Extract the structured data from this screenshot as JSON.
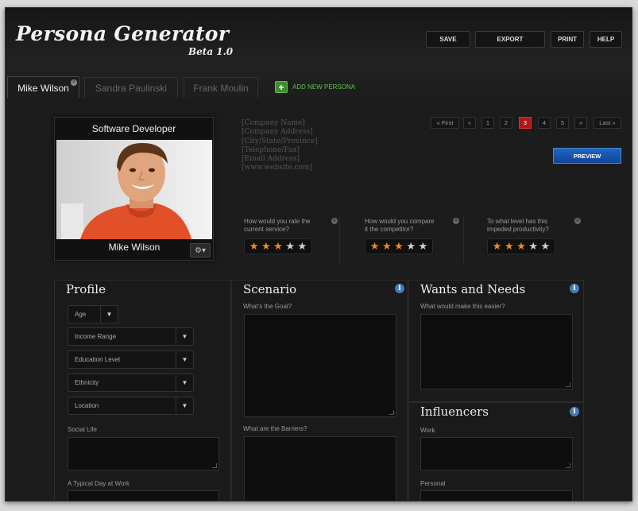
{
  "header": {
    "title": "Persona Generator",
    "subtitle": "Beta 1.0",
    "buttons": {
      "save": "SAVE",
      "export": "EXPORT",
      "print": "PRINT",
      "help": "HELP"
    }
  },
  "tabs": [
    {
      "label": "Mike Wilson",
      "active": true
    },
    {
      "label": "Sandra Paulinski",
      "active": false
    },
    {
      "label": "Frank Moulin",
      "active": false
    }
  ],
  "add_persona": {
    "icon": "plus-icon",
    "label": "ADD NEW PERSONA"
  },
  "persona": {
    "role": "Software Developer",
    "name": "Mike Wilson"
  },
  "company": {
    "name": "[Company Name]",
    "address": "[Company Address]",
    "city": "[City/State/Province]",
    "phone": "[Telephone/Fax]",
    "email": "[Email Address]",
    "website": "[www.website.com]"
  },
  "pagination": {
    "first": "« First",
    "prev": "«",
    "pages": [
      "1",
      "2",
      "3",
      "4",
      "5"
    ],
    "current": "3",
    "next": "»",
    "last": "Last »"
  },
  "preview_label": "PREVIEW",
  "ratings": [
    {
      "question_line1": "How would you rate the",
      "question_line2": "current service?",
      "stars": 3,
      "max": 5
    },
    {
      "question_line1": "How would you compare",
      "question_line2": "it the competitor?",
      "stars": 3,
      "max": 5
    },
    {
      "question_line1": "To what level has this",
      "question_line2": "impeded productivity?",
      "stars": 3,
      "max": 5
    }
  ],
  "profile": {
    "title": "Profile",
    "dropdowns": [
      "Age",
      "Income Range",
      "Education Level",
      "Ethnicity",
      "Location"
    ],
    "social_life_label": "Social Life",
    "typical_day_label": "A Typical Day at Work"
  },
  "scenario": {
    "title": "Scenario",
    "goal_label": "What's the Goal?",
    "barriers_label": "What are the Barriers?"
  },
  "wants": {
    "title": "Wants and Needs",
    "easier_label": "What would make this easier?"
  },
  "influencers": {
    "title": "Influencers",
    "work_label": "Work",
    "personal_label": "Personal"
  },
  "colors": {
    "accent_red": "#b01818",
    "preview_blue": "#1f66c2",
    "add_green": "#5ec24c",
    "star_orange": "#f08a1c"
  }
}
